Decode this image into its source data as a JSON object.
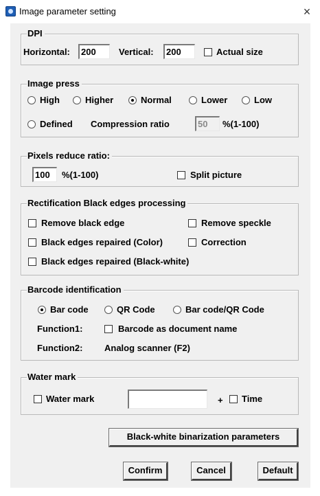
{
  "window": {
    "title": "Image parameter setting",
    "close_symbol": "×"
  },
  "dpi": {
    "legend": "DPI",
    "horizontal_label": "Horizontal:",
    "horizontal_value": "200",
    "vertical_label": "Vertical:",
    "vertical_value": "200",
    "actual_size_label": "Actual size"
  },
  "image_press": {
    "legend": "Image press",
    "options": [
      "High",
      "Higher",
      "Normal",
      "Lower",
      "Low",
      "Defined"
    ],
    "selected": "Normal",
    "compression_label": "Compression ratio",
    "compression_value": "50",
    "compression_range": "%(1-100)"
  },
  "pixels": {
    "legend": "Pixels reduce ratio:",
    "value": "100",
    "range": "%(1-100)",
    "split_label": "Split picture"
  },
  "rectification": {
    "legend": "Rectification  Black edges processing",
    "remove_black_edge": "Remove black edge",
    "remove_speckle": "Remove speckle",
    "black_edges_color": "Black edges repaired (Color)",
    "correction": "Correction",
    "black_edges_bw": "Black edges repaired (Black-white)"
  },
  "barcode": {
    "legend": "Barcode identification",
    "options": [
      "Bar code",
      "QR Code",
      "Bar code/QR Code"
    ],
    "selected": "Bar code",
    "function1_label": "Function1:",
    "function1_option": "Barcode as document name",
    "function2_label": "Function2:",
    "function2_value": "Analog scanner (F2)"
  },
  "watermark": {
    "legend": "Water mark",
    "watermark_label": "Water mark",
    "text_value": "",
    "plus": "+",
    "time_label": "Time"
  },
  "buttons": {
    "binarization": "Black-white binarization parameters",
    "confirm": "Confirm",
    "cancel": "Cancel",
    "default": "Default"
  }
}
